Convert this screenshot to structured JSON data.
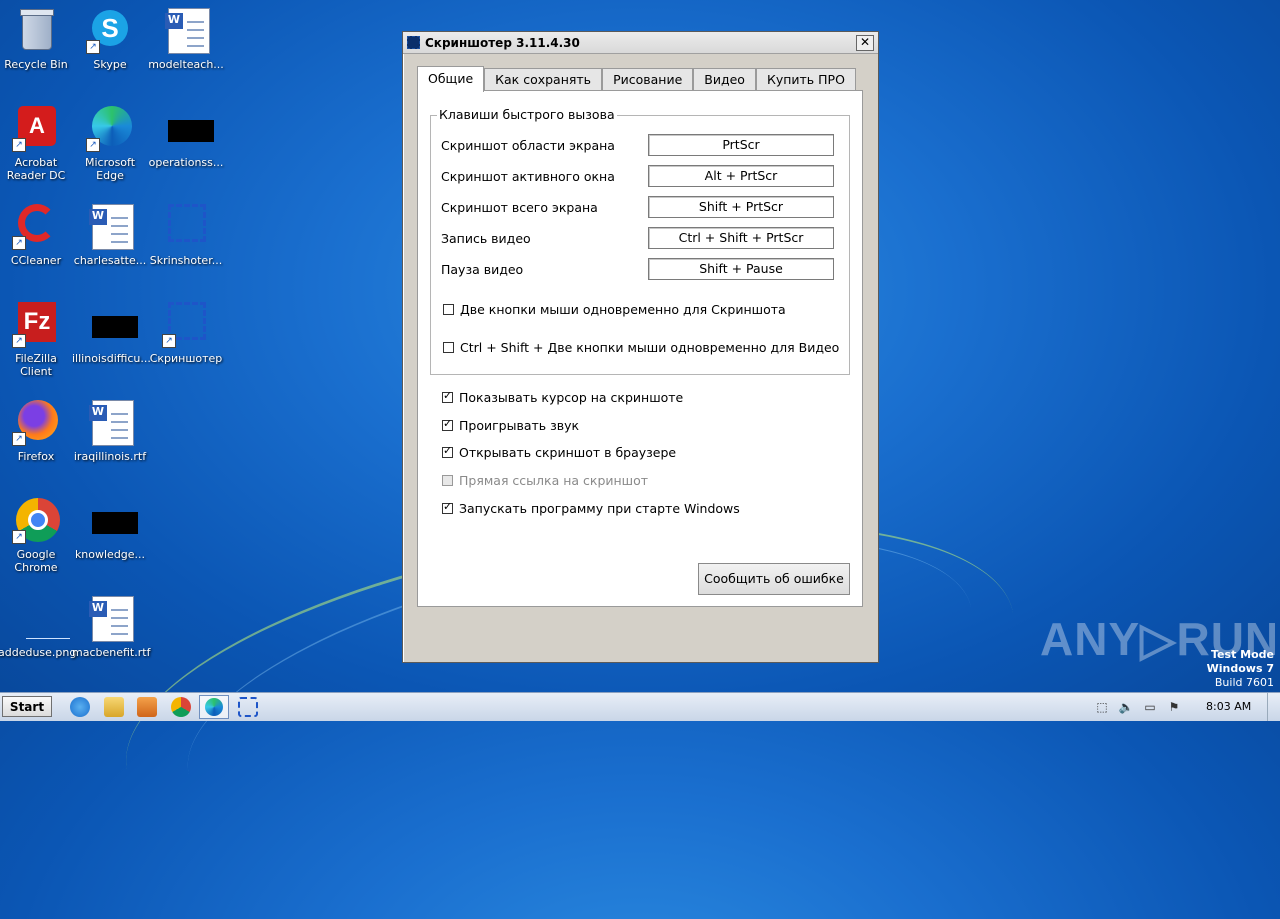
{
  "desktop": {
    "icons": [
      {
        "label": "Recycle Bin"
      },
      {
        "label": "Skype"
      },
      {
        "label": "modelteach..."
      },
      {
        "label": "Acrobat Reader DC"
      },
      {
        "label": "Microsoft Edge"
      },
      {
        "label": "operationss..."
      },
      {
        "label": "CCleaner"
      },
      {
        "label": "charlesatte..."
      },
      {
        "label": "Skrinshoter..."
      },
      {
        "label": "FileZilla Client"
      },
      {
        "label": "illinoisdifficu..."
      },
      {
        "label": "Скриншотер"
      },
      {
        "label": "Firefox"
      },
      {
        "label": "iraqillinois.rtf"
      },
      {
        "label": "Google Chrome"
      },
      {
        "label": "knowledge..."
      },
      {
        "label": "addeduse.png"
      },
      {
        "label": "macbenefit.rtf"
      }
    ]
  },
  "window": {
    "title": "Скриншотер 3.11.4.30",
    "close_glyph": "✕",
    "tabs": [
      {
        "label": "Общие",
        "active": true
      },
      {
        "label": "Как сохранять"
      },
      {
        "label": "Рисование"
      },
      {
        "label": "Видео"
      },
      {
        "label": "Купить ПРО"
      }
    ],
    "hotkeys_group_title": "Клавиши быстрого вызова",
    "hotkeys": [
      {
        "label": "Скриншот области экрана",
        "value": "PrtScr"
      },
      {
        "label": "Скриншот активного окна",
        "value": "Alt + PrtScr"
      },
      {
        "label": "Скриншот всего экрана",
        "value": "Shift + PrtScr"
      },
      {
        "label": "Запись видео",
        "value": "Ctrl + Shift + PrtScr"
      },
      {
        "label": "Пауза видео",
        "value": "Shift + Pause"
      }
    ],
    "group_checkboxes": [
      {
        "label": "Две кнопки мыши одновременно для Скриншота",
        "checked": false
      },
      {
        "label": "Ctrl + Shift + Две кнопки мыши одновременно для Видео",
        "checked": false
      }
    ],
    "options": [
      {
        "label": "Показывать курсор на скриншоте",
        "checked": true,
        "disabled": false
      },
      {
        "label": "Проигрывать звук",
        "checked": true,
        "disabled": false
      },
      {
        "label": "Открывать скриншот в браузере",
        "checked": true,
        "disabled": false
      },
      {
        "label": "Прямая ссылка на скриншот",
        "checked": false,
        "disabled": true
      },
      {
        "label": "Запускать программу при старте Windows",
        "checked": true,
        "disabled": false
      }
    ],
    "report_button": "Сообщить об ошибке"
  },
  "watermark": {
    "brand": "ANY▷RUN",
    "mode": "Test Mode",
    "os": "Windows 7",
    "build": "Build 7601"
  },
  "taskbar": {
    "start_label": "Start",
    "clock": "8:03 AM"
  },
  "colors": {
    "desktop_bg": "#1a6fcf",
    "window_bg": "#d4d0c8",
    "taskbar_bg": "#c9d6e8"
  }
}
